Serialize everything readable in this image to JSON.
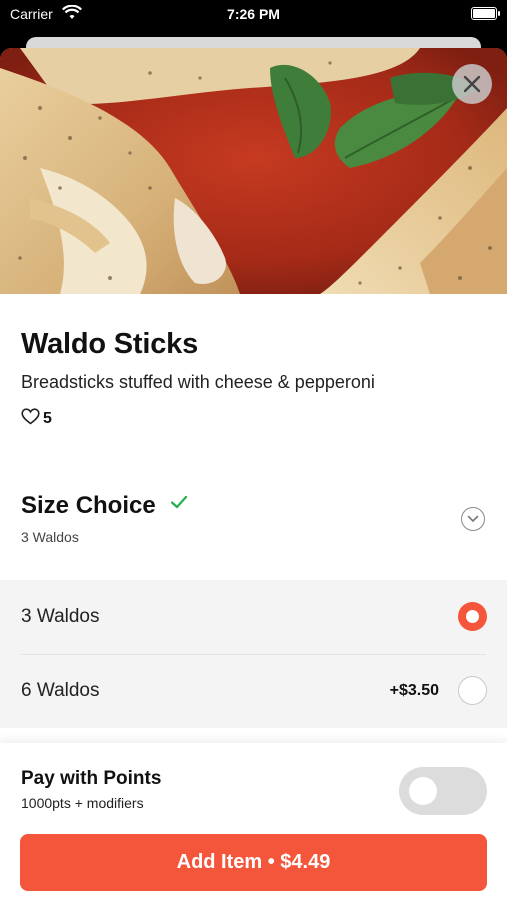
{
  "status_bar": {
    "carrier": "Carrier",
    "time": "7:26 PM"
  },
  "item": {
    "name": "Waldo Sticks",
    "description": "Breadsticks stuffed with cheese & pepperoni",
    "likes": "5"
  },
  "size_section": {
    "title": "Size Choice",
    "selected_summary": "3 Waldos",
    "options": [
      {
        "label": "3 Waldos",
        "price": "",
        "selected": true
      },
      {
        "label": "6 Waldos",
        "price": "+$3.50",
        "selected": false
      }
    ]
  },
  "points": {
    "title": "Pay with Points",
    "subtitle": "1000pts + modifiers",
    "enabled": false
  },
  "add_button": {
    "label": "Add Item • $4.49"
  },
  "colors": {
    "accent": "#f4563b",
    "check": "#22b14c"
  },
  "icons": [
    "wifi-icon",
    "battery-icon",
    "close-icon",
    "heart-icon",
    "check-icon",
    "chevron-down-icon"
  ]
}
